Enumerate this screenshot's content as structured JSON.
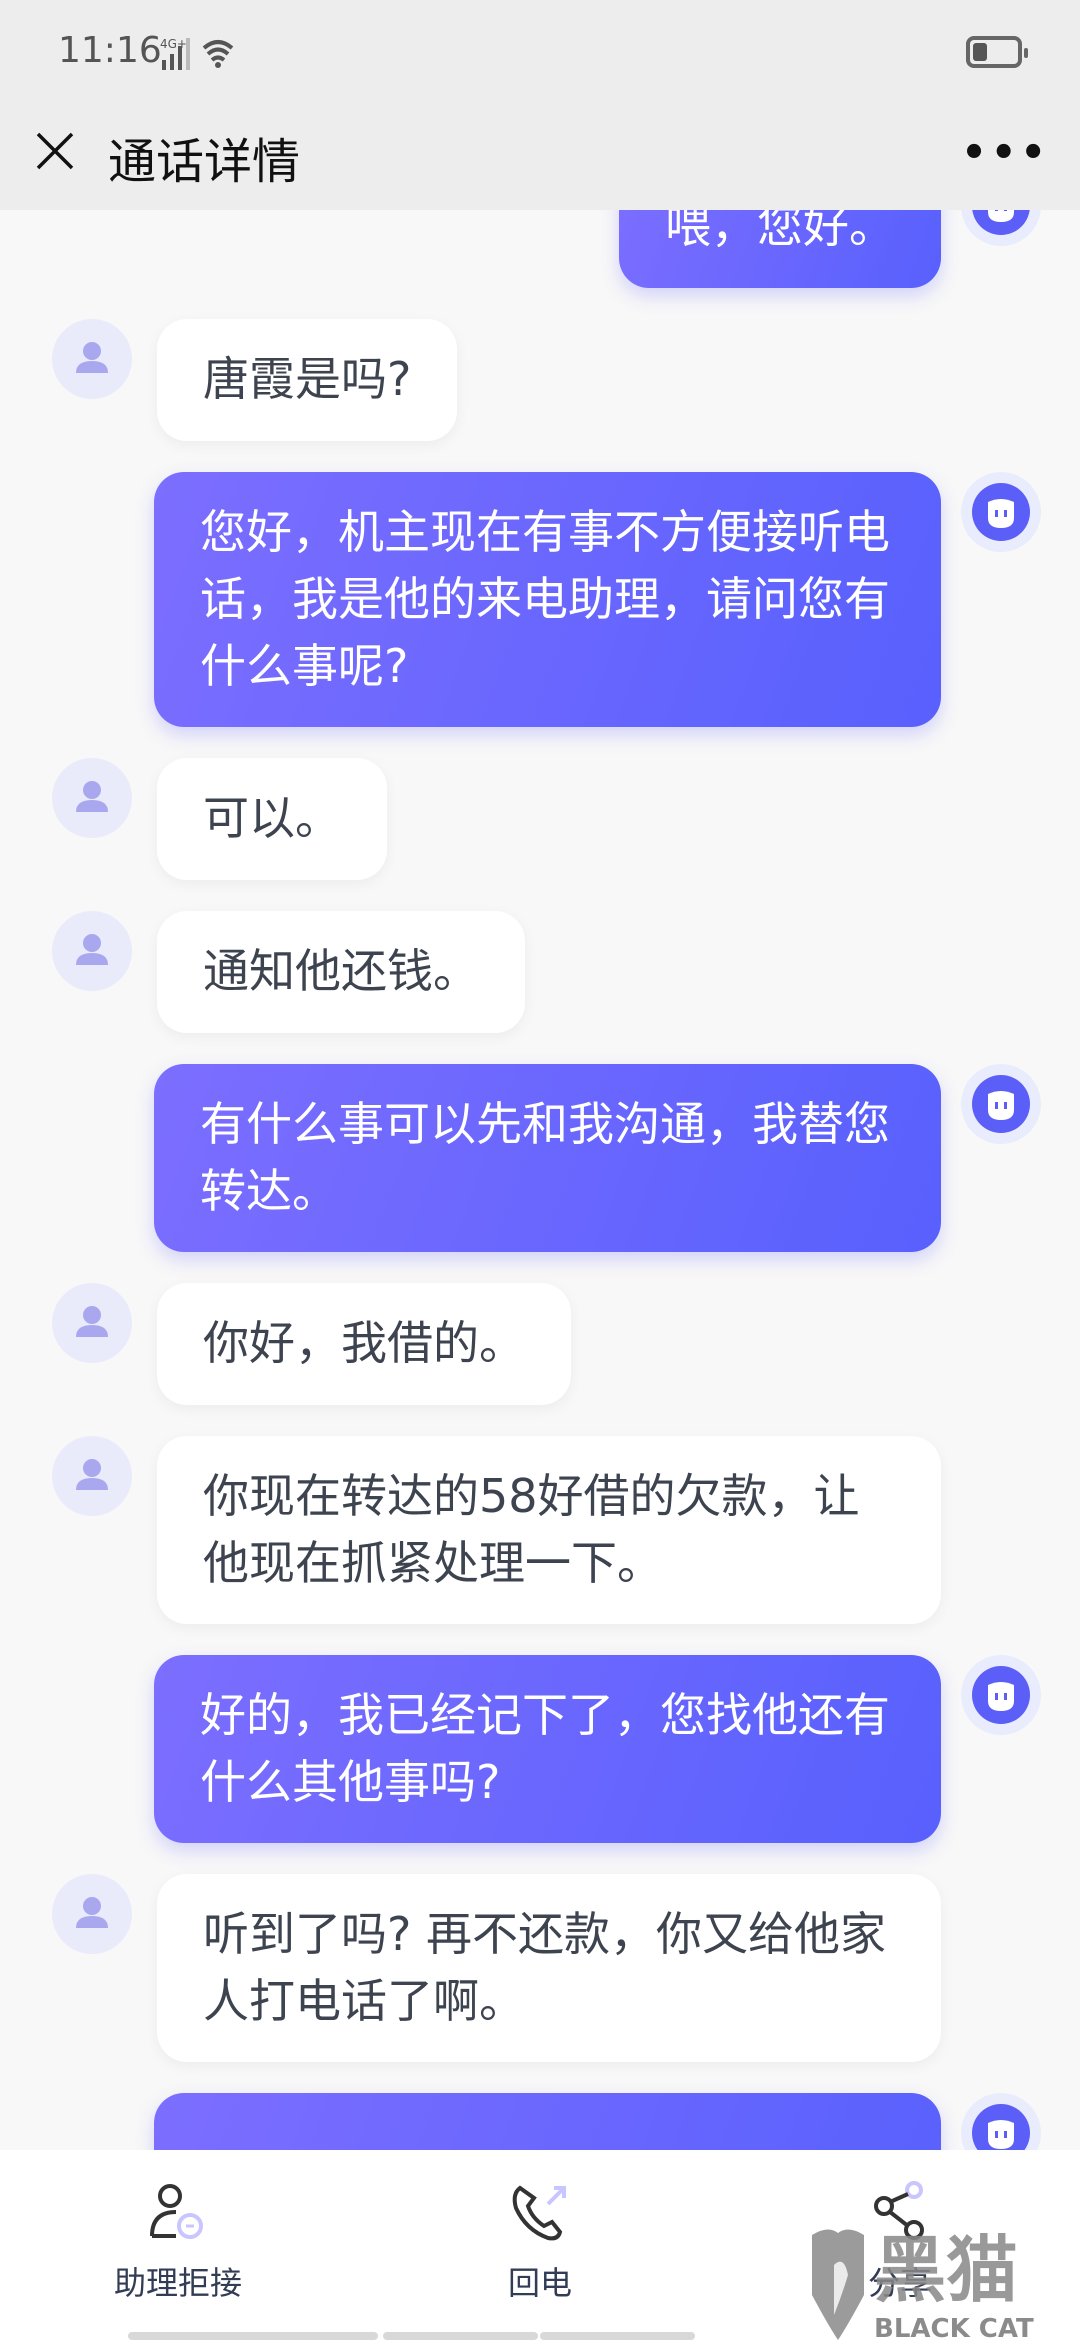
{
  "status_bar": {
    "time": "11:16",
    "network": "4G+",
    "icons": [
      "signal-icon",
      "wifi-icon",
      "battery-icon"
    ]
  },
  "header": {
    "title": "通话详情",
    "close_icon": "close-icon",
    "more_icon": "more-icon",
    "more_label": "•••"
  },
  "colors": {
    "outgoing_start": "#7c6eff",
    "outgoing_end": "#5860fd",
    "incoming_bg": "#ffffff",
    "header_bg": "#ededed"
  },
  "messages": [
    {
      "from": "assistant",
      "text": "喂，您好。"
    },
    {
      "from": "caller",
      "text": "唐霞是吗?"
    },
    {
      "from": "assistant",
      "text": "您好，机主现在有事不方便接听电话，我是他的来电助理，请问您有什么事呢?"
    },
    {
      "from": "caller",
      "text": "可以。"
    },
    {
      "from": "caller",
      "text": "通知他还钱。"
    },
    {
      "from": "assistant",
      "text": "有什么事可以先和我沟通，我替您转达。"
    },
    {
      "from": "caller",
      "text": "你好，我借的。"
    },
    {
      "from": "caller",
      "text": "你现在转达的58好借的欠款，让他现在抓紧处理一下。"
    },
    {
      "from": "assistant",
      "text": "好的，我已经记下了，您找他还有什么其他事吗?"
    },
    {
      "from": "caller",
      "text": "听到了吗? 再不还款，你又给他家人打电话了啊。"
    },
    {
      "from": "assistant",
      "text": ""
    }
  ],
  "bottom_bar": [
    {
      "label": "助理拒接",
      "icon": "user-reject-icon"
    },
    {
      "label": "回电",
      "icon": "call-back-icon"
    },
    {
      "label": "分享",
      "icon": "share-icon"
    }
  ],
  "watermark": {
    "text": "黑猫",
    "subtext": "BLACK CAT"
  }
}
